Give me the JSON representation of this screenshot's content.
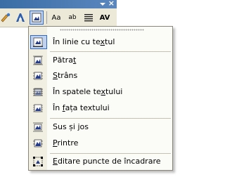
{
  "toolbar": {
    "close_glyph": "×",
    "buttons": [
      {
        "name": "picture-tool-button",
        "icon": "picture-tool-icon"
      },
      {
        "name": "text-effects-button",
        "icon": "text-effects-icon"
      },
      {
        "name": "text-wrapping-button",
        "icon": "text-wrapping-icon",
        "pressed": true
      },
      {
        "name": "same-letter-heights-button",
        "label": "Aa"
      },
      {
        "name": "vertical-text-button",
        "label": "ab"
      },
      {
        "name": "alignment-button",
        "icon": "align-icon"
      },
      {
        "name": "character-spacing-button",
        "label": "AV"
      }
    ]
  },
  "menu": {
    "items": [
      {
        "pre": "În linie cu te",
        "acc": "x",
        "post": "tul",
        "icon": "in-line-icon",
        "highlight": true
      },
      {
        "pre": "Pătra",
        "acc": "t",
        "post": "",
        "icon": "square-wrap-icon"
      },
      {
        "pre": "",
        "acc": "S",
        "post": "trâns",
        "icon": "tight-wrap-icon"
      },
      {
        "pre": "În spatele te",
        "acc": "x",
        "post": "tului",
        "icon": "behind-text-icon"
      },
      {
        "pre": "În ",
        "acc": "f",
        "post": "ața textului",
        "icon": "in-front-icon"
      },
      {
        "pre": "Sus și ",
        "acc": "j",
        "post": "os",
        "icon": "top-bottom-icon"
      },
      {
        "pre": "",
        "acc": "P",
        "post": "rintre",
        "icon": "through-icon"
      },
      {
        "pre": "",
        "acc": "E",
        "post": "ditare puncte de încadrare",
        "icon": "edit-wrap-points-icon"
      }
    ]
  }
}
